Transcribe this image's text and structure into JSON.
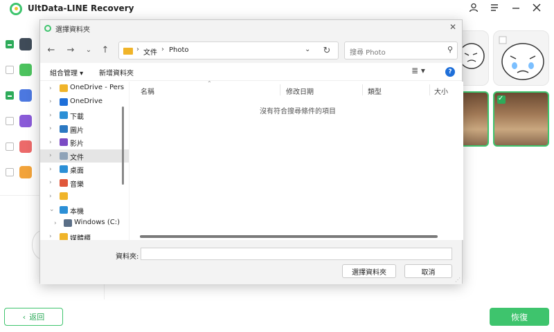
{
  "app": {
    "title": "UltData-LINE Recovery",
    "icons": [
      "user-icon",
      "menu-icon",
      "minimize-icon",
      "close-icon"
    ],
    "back_label": "返回",
    "recover_label": "恢復",
    "accent": "#3ec46d"
  },
  "dialog": {
    "title": "選擇資料夾",
    "breadcrumb": [
      "文件",
      "Photo"
    ],
    "search_placeholder": "搜尋 Photo",
    "toolbar": {
      "organize": "組合管理 ▾",
      "new_folder": "新增資料夾"
    },
    "tree": [
      {
        "label": "OneDrive - Pers",
        "icon": "folder-icon",
        "color": "#f0b429"
      },
      {
        "label": "OneDrive",
        "icon": "cloud-icon",
        "color": "#1e6fd9"
      },
      {
        "label": "下載",
        "icon": "download-icon",
        "color": "#2b8fd6"
      },
      {
        "label": "圖片",
        "icon": "pictures-icon",
        "color": "#2b78c2"
      },
      {
        "label": "影片",
        "icon": "video-icon",
        "color": "#7b4bc4"
      },
      {
        "label": "文件",
        "icon": "documents-icon",
        "color": "#8fa3b8",
        "selected": true
      },
      {
        "label": "桌面",
        "icon": "desktop-icon",
        "color": "#2b8fd6"
      },
      {
        "label": "音樂",
        "icon": "music-icon",
        "color": "#e0573a"
      },
      {
        "label": "",
        "icon": "folder-icon",
        "color": "#f0b429"
      },
      {
        "label": "本機",
        "icon": "pc-icon",
        "color": "#2b8fd6"
      },
      {
        "label": "Windows (C:)",
        "icon": "drive-icon",
        "color": "#5a6e86"
      },
      {
        "label": "媒體櫃",
        "icon": "library-icon",
        "color": "#f0b429"
      }
    ],
    "columns": [
      "名稱",
      "修改日期",
      "類型",
      "大小"
    ],
    "empty_message": "沒有符合搜尋條件的項目",
    "folder_label": "資料夾:",
    "folder_value": "",
    "select_button": "選擇資料夾",
    "cancel_button": "取消"
  }
}
